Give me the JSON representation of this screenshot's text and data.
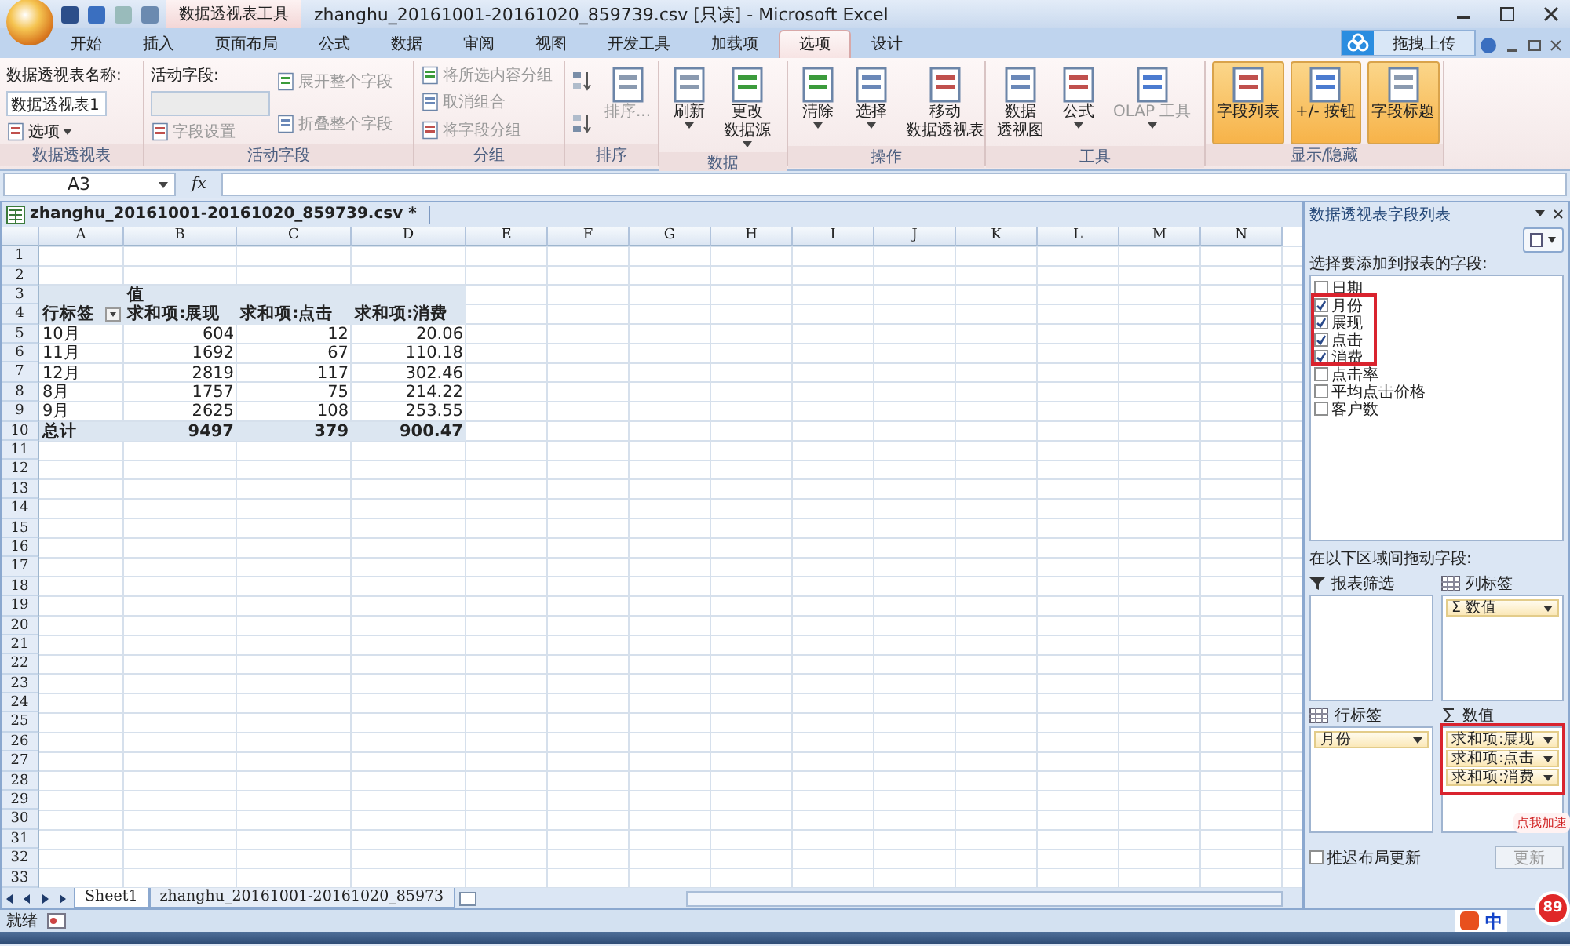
{
  "title_bar": {
    "context_tab": "数据透视表工具",
    "title": "zhanghu_20161001-20161020_859739.csv  [只读]  -  Microsoft Excel"
  },
  "tabs": [
    {
      "label": "开始",
      "selected": false
    },
    {
      "label": "插入",
      "selected": false
    },
    {
      "label": "页面布局",
      "selected": false
    },
    {
      "label": "公式",
      "selected": false
    },
    {
      "label": "数据",
      "selected": false
    },
    {
      "label": "审阅",
      "selected": false
    },
    {
      "label": "视图",
      "selected": false
    },
    {
      "label": "开发工具",
      "selected": false
    },
    {
      "label": "加载项",
      "selected": false
    },
    {
      "label": "选项",
      "selected": true
    },
    {
      "label": "设计",
      "selected": false
    }
  ],
  "upload_button": "拖拽上传",
  "ribbon": [
    {
      "label": "数据透视表",
      "items": [
        {
          "kind": "stack",
          "items": [
            {
              "kind": "caption",
              "label": "数据透视表名称:"
            },
            {
              "kind": "input",
              "value": "数据透视表1"
            },
            {
              "kind": "small",
              "label": "选项",
              "dropdown": true,
              "disabled": false
            }
          ]
        }
      ]
    },
    {
      "label": "活动字段",
      "items": [
        {
          "kind": "stack",
          "items": [
            {
              "kind": "caption",
              "label": "活动字段:"
            },
            {
              "kind": "input"
            },
            {
              "kind": "small",
              "label": "字段设置",
              "dropdown": false,
              "disabled": true
            }
          ]
        },
        {
          "kind": "stack",
          "items": [
            {
              "kind": "small",
              "label": "展开整个字段",
              "dropdown": false,
              "disabled": true
            },
            {
              "kind": "small",
              "label": "折叠整个字段",
              "dropdown": false,
              "disabled": true
            }
          ]
        }
      ]
    },
    {
      "label": "分组",
      "items": [
        {
          "kind": "stack",
          "items": [
            {
              "kind": "small",
              "label": "将所选内容分组",
              "dropdown": false,
              "disabled": true
            },
            {
              "kind": "small",
              "label": "取消组合",
              "dropdown": false,
              "disabled": true
            },
            {
              "kind": "small",
              "label": "将字段分组",
              "dropdown": false,
              "disabled": true
            }
          ]
        }
      ]
    },
    {
      "label": "排序",
      "items": [
        {
          "kind": "stack",
          "items": [
            {
              "kind": "sort_az"
            },
            {
              "kind": "sort_za"
            }
          ]
        },
        {
          "kind": "large",
          "lines": [
            "排序..."
          ],
          "dropdown": false,
          "disabled": true,
          "on": false
        }
      ]
    },
    {
      "label": "数据",
      "items": [
        {
          "kind": "large",
          "lines": [
            "刷新"
          ],
          "dropdown": true,
          "disabled": false,
          "on": false
        },
        {
          "kind": "large",
          "lines": [
            "更改",
            "数据源"
          ],
          "dropdown": true,
          "disabled": false,
          "on": false
        }
      ]
    },
    {
      "label": "操作",
      "items": [
        {
          "kind": "large",
          "lines": [
            "清除"
          ],
          "dropdown": true,
          "disabled": false,
          "on": false
        },
        {
          "kind": "large",
          "lines": [
            "选择"
          ],
          "dropdown": true,
          "disabled": false,
          "on": false
        },
        {
          "kind": "large",
          "lines": [
            "移动",
            "数据透视表"
          ],
          "dropdown": false,
          "disabled": false,
          "on": false
        }
      ]
    },
    {
      "label": "工具",
      "items": [
        {
          "kind": "large",
          "lines": [
            "数据",
            "透视图"
          ],
          "dropdown": false,
          "disabled": false,
          "on": false
        },
        {
          "kind": "large",
          "lines": [
            "公式"
          ],
          "dropdown": true,
          "disabled": false,
          "on": false
        },
        {
          "kind": "large",
          "lines": [
            "OLAP 工具"
          ],
          "dropdown": true,
          "disabled": true,
          "on": false
        }
      ]
    },
    {
      "label": "显示/隐藏",
      "items": [
        {
          "kind": "large",
          "lines": [
            "字段列表"
          ],
          "dropdown": false,
          "disabled": false,
          "on": true
        },
        {
          "kind": "large",
          "lines": [
            "+/- 按钮"
          ],
          "dropdown": false,
          "disabled": false,
          "on": true
        },
        {
          "kind": "large",
          "lines": [
            "字段标题"
          ],
          "dropdown": false,
          "disabled": false,
          "on": true
        }
      ]
    }
  ],
  "formula_bar": {
    "name_box": "A3",
    "fx_label": "fx"
  },
  "workbook": {
    "title": "zhanghu_20161001-20161020_859739.csv *",
    "columns": [
      "A",
      "B",
      "C",
      "D",
      "E",
      "F",
      "G",
      "H",
      "I",
      "J",
      "K",
      "L",
      "M",
      "N"
    ],
    "row_numbers": [
      "1",
      "2",
      "3",
      "4",
      "5",
      "6",
      "7",
      "8",
      "9",
      "10",
      "11",
      "12",
      "13",
      "14",
      "15",
      "16",
      "17",
      "18",
      "19",
      "20",
      "21",
      "22",
      "23",
      "24",
      "25",
      "26",
      "27",
      "28",
      "29",
      "30",
      "31",
      "32",
      "33"
    ],
    "pivot": {
      "value_caption": "值",
      "row_label": "行标签",
      "headers": [
        "求和项:展现",
        "求和项:点击",
        "求和项:消费"
      ],
      "rows": [
        {
          "label": "10月",
          "values": [
            "604",
            "12",
            "20.06"
          ]
        },
        {
          "label": "11月",
          "values": [
            "1692",
            "67",
            "110.18"
          ]
        },
        {
          "label": "12月",
          "values": [
            "2819",
            "117",
            "302.46"
          ]
        },
        {
          "label": "8月",
          "values": [
            "1757",
            "75",
            "214.22"
          ]
        },
        {
          "label": "9月",
          "values": [
            "2625",
            "108",
            "253.55"
          ]
        }
      ],
      "total": {
        "label": "总计",
        "values": [
          "9497",
          "379",
          "900.47"
        ]
      }
    },
    "sheet_tabs": [
      {
        "label": "Sheet1",
        "selected": true
      },
      {
        "label": "zhanghu_20161001-20161020_85973",
        "selected": false
      }
    ]
  },
  "pivot_pane": {
    "title": "数据透视表字段列表",
    "choose_label": "选择要添加到报表的字段:",
    "fields": [
      {
        "label": "日期",
        "checked": false
      },
      {
        "label": "月份",
        "checked": true
      },
      {
        "label": "展现",
        "checked": true
      },
      {
        "label": "点击",
        "checked": true
      },
      {
        "label": "消费",
        "checked": true
      },
      {
        "label": "点击率",
        "checked": false
      },
      {
        "label": "平均点击价格",
        "checked": false
      },
      {
        "label": "客户数",
        "checked": false
      }
    ],
    "drag_label": "在以下区域间拖动字段:",
    "areas": [
      {
        "label": "报表筛选",
        "kind": "filter"
      },
      {
        "label": "列标签",
        "kind": "columns",
        "items": [
          "Σ 数值"
        ]
      },
      {
        "label": "行标签",
        "kind": "rows",
        "items": [
          "月份"
        ]
      },
      {
        "label": "数值",
        "kind": "values",
        "items": [
          "求和项:展现",
          "求和项:点击",
          "求和项:消费"
        ]
      }
    ],
    "defer_label": "推迟布局更新",
    "defer_checked": false,
    "update_button": "更新"
  },
  "status_bar": {
    "text": "就绪",
    "ime": "中"
  },
  "speed_ball": {
    "bubble": "点我加速",
    "badge": "89"
  }
}
